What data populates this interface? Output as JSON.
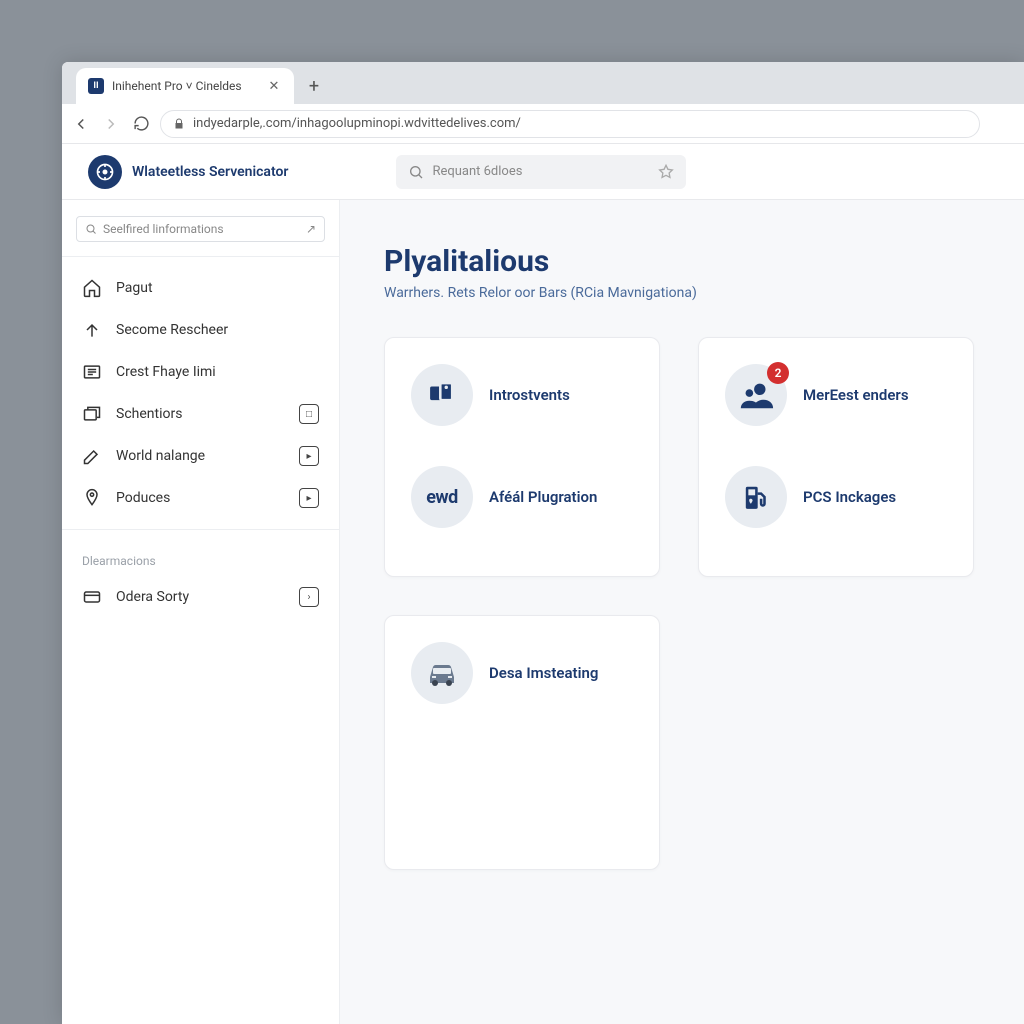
{
  "browser": {
    "tab_title": "Inihehent Pro ˅ Cineldes",
    "tab_favicon_text": "II",
    "url": "indyedarple,.com/inhagoolupminopi.wdvittedelives.com/"
  },
  "header": {
    "brand_name": "Wlateetless Servenicator",
    "search_placeholder": "Requant 6dloes"
  },
  "sidebar": {
    "filter_placeholder": "Seelfired linformations",
    "items": [
      {
        "label": "Pagut",
        "icon": "home"
      },
      {
        "label": "Secome Rescheer",
        "icon": "up"
      },
      {
        "label": "Crest Fhaye Iimi",
        "icon": "list"
      },
      {
        "label": "Schentiors",
        "icon": "box",
        "badge": "□"
      },
      {
        "label": "World nalange",
        "icon": "pen",
        "badge": "▸"
      },
      {
        "label": "Poduces",
        "icon": "pin",
        "badge": "▸"
      }
    ],
    "section_label": "Dlearmacions",
    "section_items": [
      {
        "label": "Odera Sorty",
        "icon": "card",
        "badge": "›"
      }
    ]
  },
  "main": {
    "title": "Plyalitalious",
    "subtitle": "Warrhers. Rets Relor oor Bars (RCia Mavnigationa)",
    "cards": [
      {
        "rows": [
          {
            "label": "Introstvents",
            "icon": "device"
          },
          {
            "label": "Aféál Plugration",
            "icon": "ewd"
          }
        ]
      },
      {
        "rows": [
          {
            "label": "MerEest enders",
            "icon": "people",
            "badge": "2"
          },
          {
            "label": "PCS Inckages",
            "icon": "fuel"
          }
        ]
      },
      {
        "rows": [
          {
            "label": "Desa Imsteating",
            "icon": "car"
          }
        ]
      }
    ]
  }
}
